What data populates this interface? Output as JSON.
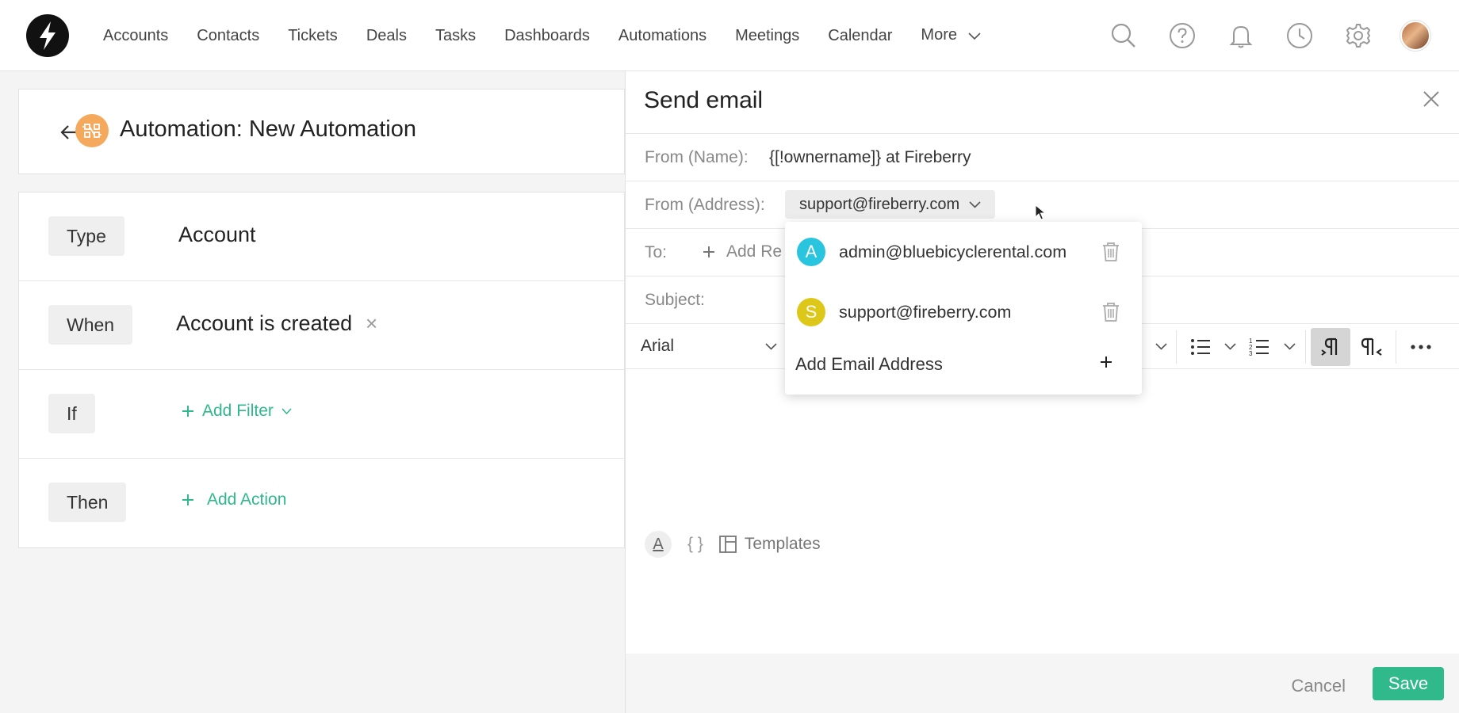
{
  "nav": {
    "items": [
      "Accounts",
      "Contacts",
      "Tickets",
      "Deals",
      "Tasks",
      "Dashboards",
      "Automations",
      "Meetings",
      "Calendar"
    ],
    "more_label": "More"
  },
  "automation": {
    "title": "Automation: New Automation"
  },
  "rules": {
    "type": {
      "chip": "Type",
      "value": "Account"
    },
    "when": {
      "chip": "When",
      "value": "Account is created",
      "remove": "×"
    },
    "if": {
      "chip": "If",
      "link": "Add Filter"
    },
    "then": {
      "chip": "Then",
      "link": "Add Action"
    }
  },
  "panel": {
    "title": "Send email",
    "from_name_label": "From (Name):",
    "from_name_value": "{[!ownername]} at Fireberry",
    "from_address_label": "From (Address):",
    "from_address_value": "support@fireberry.com",
    "to_label": "To:",
    "add_recipient": "Add Re",
    "subject_label": "Subject:",
    "font": "Arial",
    "braces": "{ }",
    "templates_label": "Templates",
    "cancel_label": "Cancel",
    "save_label": "Save"
  },
  "dropdown": {
    "items": [
      {
        "initial": "A",
        "email": "admin@bluebicyclerental.com",
        "color": "#29c4dd"
      },
      {
        "initial": "S",
        "email": "support@fireberry.com",
        "color": "#ddc81a"
      }
    ],
    "add_label": "Add Email Address"
  },
  "colors": {
    "accent_green": "#30b98a",
    "automation_orange": "#f5a95c"
  }
}
